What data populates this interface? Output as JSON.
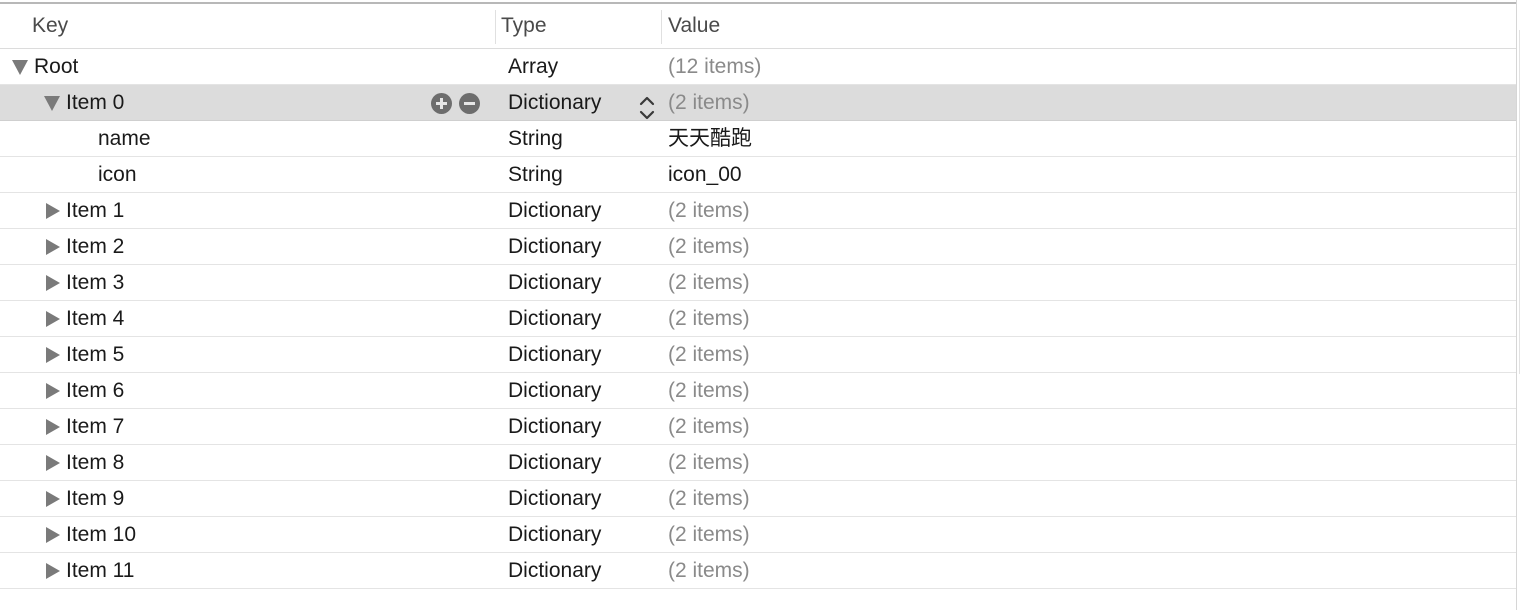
{
  "header": {
    "key": "Key",
    "type": "Type",
    "value": "Value"
  },
  "rows": [
    {
      "key": "Root",
      "type": "Array",
      "value": "(12 items)",
      "level": 0,
      "state": "expanded"
    },
    {
      "key": "Item 0",
      "type": "Dictionary",
      "value": "(2 items)",
      "level": 1,
      "state": "expanded",
      "selected": true
    },
    {
      "key": "name",
      "type": "String",
      "value": "天天酷跑",
      "level": 2,
      "state": "leaf"
    },
    {
      "key": "icon",
      "type": "String",
      "value": "icon_00",
      "level": 2,
      "state": "leaf"
    },
    {
      "key": "Item 1",
      "type": "Dictionary",
      "value": "(2 items)",
      "level": 1,
      "state": "collapsed"
    },
    {
      "key": "Item 2",
      "type": "Dictionary",
      "value": "(2 items)",
      "level": 1,
      "state": "collapsed"
    },
    {
      "key": "Item 3",
      "type": "Dictionary",
      "value": "(2 items)",
      "level": 1,
      "state": "collapsed"
    },
    {
      "key": "Item 4",
      "type": "Dictionary",
      "value": "(2 items)",
      "level": 1,
      "state": "collapsed"
    },
    {
      "key": "Item 5",
      "type": "Dictionary",
      "value": "(2 items)",
      "level": 1,
      "state": "collapsed"
    },
    {
      "key": "Item 6",
      "type": "Dictionary",
      "value": "(2 items)",
      "level": 1,
      "state": "collapsed"
    },
    {
      "key": "Item 7",
      "type": "Dictionary",
      "value": "(2 items)",
      "level": 1,
      "state": "collapsed"
    },
    {
      "key": "Item 8",
      "type": "Dictionary",
      "value": "(2 items)",
      "level": 1,
      "state": "collapsed"
    },
    {
      "key": "Item 9",
      "type": "Dictionary",
      "value": "(2 items)",
      "level": 1,
      "state": "collapsed"
    },
    {
      "key": "Item 10",
      "type": "Dictionary",
      "value": "(2 items)",
      "level": 1,
      "state": "collapsed"
    },
    {
      "key": "Item 11",
      "type": "Dictionary",
      "value": "(2 items)",
      "level": 1,
      "state": "collapsed"
    }
  ],
  "icons": {
    "expanded": "disclosure-triangle-down-icon",
    "collapsed": "disclosure-triangle-right-icon",
    "add": "plus-circle-icon",
    "remove": "minus-circle-icon",
    "stepper": "up-down-chevron-icon"
  },
  "colors": {
    "selected_row": "#dcdcdc",
    "muted_value": "#8a8a8a",
    "triangle": "#7a7a7a"
  }
}
